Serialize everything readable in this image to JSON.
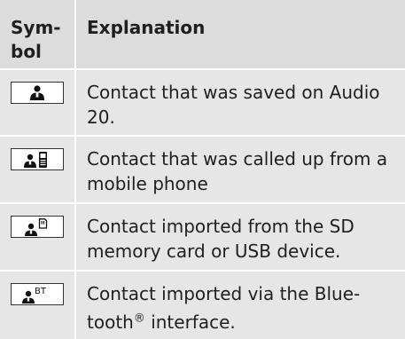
{
  "header": {
    "symbol_label": "Sym-\nbol",
    "explanation_label": "Explanation"
  },
  "rows": [
    {
      "icon": "contact-person-icon",
      "text": "Contact that was saved on Audio 20."
    },
    {
      "icon": "contact-phone-icon",
      "text": "Contact that was called up from a mobile phone"
    },
    {
      "icon": "contact-sd-card-icon",
      "text": "Contact imported from the SD memory card or USB device."
    },
    {
      "icon": "contact-bluetooth-icon",
      "text": "Contact imported via the Blue-tooth® interface.",
      "icon_label": "BT"
    }
  ]
}
